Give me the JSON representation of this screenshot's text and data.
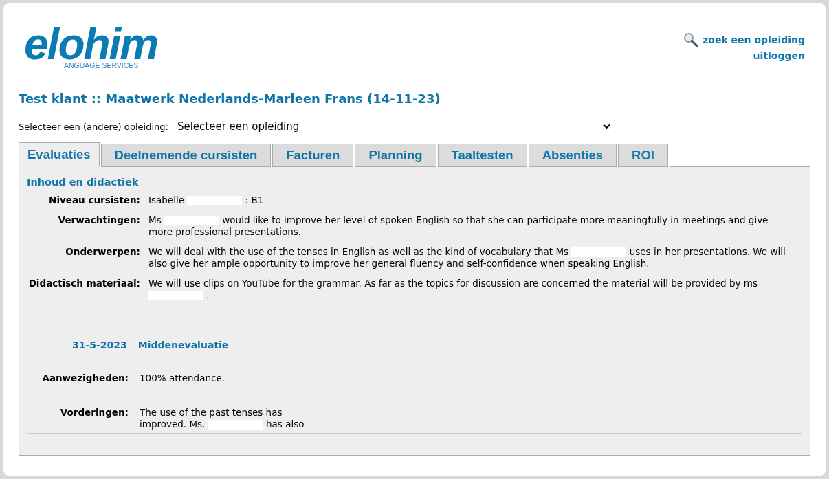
{
  "logo": {
    "wordmark": "elohim",
    "tagline": "ANGUAGE SERVICES"
  },
  "header_links": [
    {
      "label": "zoek een opleiding",
      "kind": "search"
    },
    {
      "label": "uitloggen",
      "kind": "plain"
    }
  ],
  "page_title": "Test klant :: Maatwerk Nederlands-Marleen Frans (14-11-23)",
  "course_select": {
    "label": "Selecteer een (andere) opleiding:",
    "value": "Selecteer een opleiding"
  },
  "tabs": [
    {
      "label": "Evaluaties",
      "selected": true
    },
    {
      "label": "Deelnemende cursisten",
      "selected": false
    },
    {
      "label": "Facturen",
      "selected": false
    },
    {
      "label": "Planning",
      "selected": false
    },
    {
      "label": "Taaltesten",
      "selected": false
    },
    {
      "label": "Absenties",
      "selected": false
    },
    {
      "label": "ROI",
      "selected": false
    }
  ],
  "section_title": "Inhoud en didactiek",
  "fields": [
    {
      "label": "Niveau cursisten:",
      "segments": [
        "Isabelle",
        ": B1"
      ]
    },
    {
      "label": "Verwachtingen:",
      "segments": [
        "Ms",
        "would like to improve her level of spoken English so that she can participate more meaningfully in meetings and give more professional presentations."
      ]
    },
    {
      "label": "Onderwerpen:",
      "segments": [
        "We will deal with the use of the tenses in English as well as the kind of vocabulary that Ms",
        "uses in her presentations. We will also give her ample opportunity to improve her general fluency and self-confidence when speaking English."
      ]
    },
    {
      "label": "Didactisch materiaal:",
      "segments": [
        "We will use clips on YouTube for the grammar. As far as the topics for discussion are concerned the material will be provided by ms",
        "."
      ]
    }
  ],
  "evaluation": {
    "date": "31-5-2023",
    "title": "Middenevaluatie",
    "fields": [
      {
        "label": "Aanwezigheden:",
        "segments": [
          "100% attendance."
        ]
      },
      {
        "label": "Vorderingen:",
        "segments": [
          "The use of the past tenses has improved. Ms.",
          "has also"
        ]
      }
    ]
  }
}
